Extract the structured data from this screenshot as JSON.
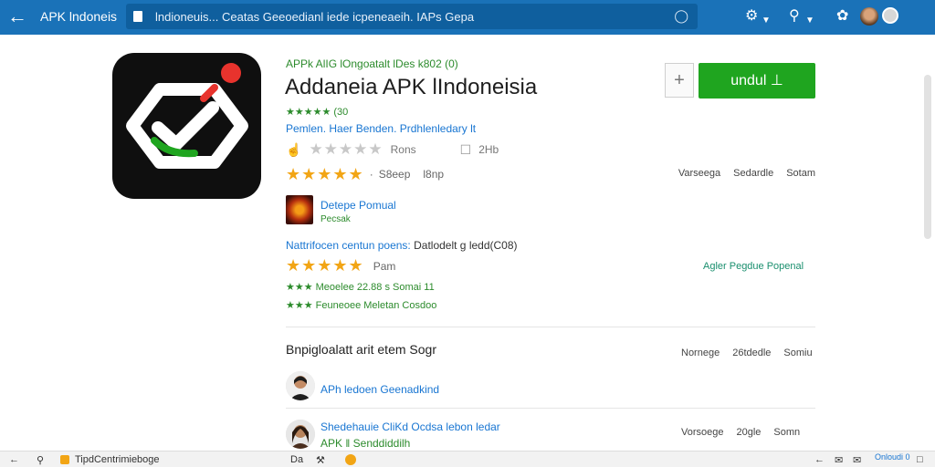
{
  "topbar": {
    "back_icon": "arrow-left-icon",
    "app_title": "APK lndoneis",
    "url_text": "lndioneuis... Ceatas  Geeoedianl iede icpeneaeih. IAPs  Gepa",
    "icons": [
      "android-icon",
      "search-icon",
      "settings-icon",
      "avatar"
    ],
    "accent": "#1a72b8"
  },
  "app": {
    "breadcrumb": "APPk AlIG lOngoatalt lDes k802 (0)",
    "title": "Addaneia APK lIndoneisia",
    "rating_line": "★★★★★ (30",
    "developer_line": "Pemlen. Haer  Benden.  Prdhlenledary lt",
    "grey_stars": "★★★★★",
    "rate_label": "Rons",
    "count_label": "2Hb",
    "add_label": "+",
    "install_label": "undul ⊥"
  },
  "row1": {
    "stars": "★★★★★",
    "dot": "·",
    "label_a": "S8eep",
    "label_b": "l8np",
    "meta": [
      "Varseega",
      "Sedardle",
      "Sotam"
    ]
  },
  "developer": {
    "name": "Detepe  Pomual",
    "sub": "Pecsak"
  },
  "info": {
    "label": "Nattrifocen centun poens:",
    "value": "Datlodelt g ledd(C08)"
  },
  "row2": {
    "stars": "★★★★★",
    "label": "Pam",
    "link": "Agler  Pegdue   Popenal",
    "line_a": "★★★ Meoelee 22.88 s  Somai 11",
    "line_b": "★★★ Feuneoee Meletan Cosdoo"
  },
  "section": {
    "title": "Bnpigloalatt arit etem Sogr",
    "meta": [
      "Nornege",
      "26tdedle",
      "Somiu"
    ]
  },
  "reviews": [
    {
      "name": "APh  ledoen  Geenadkind",
      "sub": ""
    },
    {
      "name": "Shedehauie CliKd Ocdsa lebon ledar",
      "sub": "APK  ‖  Senddiddilh"
    }
  ],
  "review_meta2": [
    "Vorsoege",
    "20gle",
    "Somn"
  ],
  "taskbar": {
    "left_label": "TipdCentrimieboge",
    "mid_a": "Da",
    "clock": "Onloudi 0"
  }
}
